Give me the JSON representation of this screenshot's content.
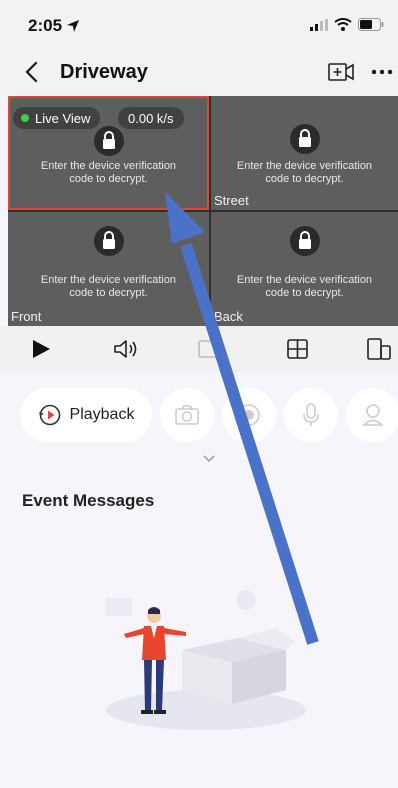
{
  "status": {
    "time": "2:05"
  },
  "nav": {
    "title": "Driveway"
  },
  "video": {
    "live_label": "Live View",
    "speed": "0.00 k/s",
    "message": "Enter the device verification code to decrypt.",
    "cells": [
      {
        "label": ""
      },
      {
        "label": "Street"
      },
      {
        "label": "Front"
      },
      {
        "label": "Back"
      }
    ]
  },
  "actions": {
    "playback_label": "Playback"
  },
  "events": {
    "title": "Event Messages"
  },
  "colors": {
    "accent_red": "#e04545",
    "live_green": "#3bd24a",
    "arrow_blue": "#4a72c8"
  }
}
